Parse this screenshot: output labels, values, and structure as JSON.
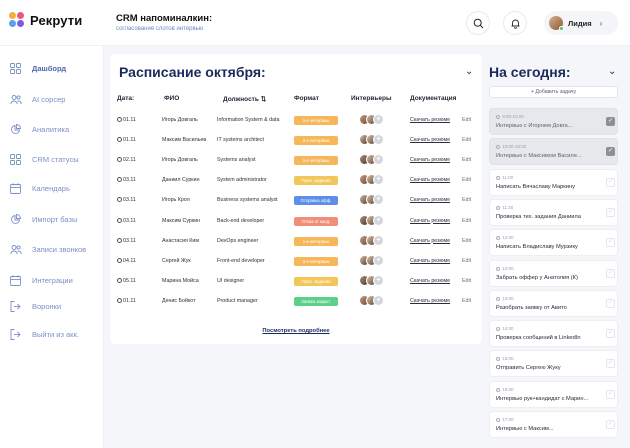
{
  "app": {
    "logo_text": "Рекрути"
  },
  "header": {
    "title": "CRM напоминалкин:",
    "subtitle": "согласование слотов интервью",
    "user_name": "Лидия"
  },
  "sidebar": {
    "items": [
      {
        "label": "Дашборд",
        "icon": "grid-icon",
        "active": true
      },
      {
        "label": "AI сорсер",
        "icon": "people-icon"
      },
      {
        "label": "Аналитика",
        "icon": "pie-chart-icon"
      },
      {
        "label": "CRM статусы",
        "icon": "grid-icon"
      },
      {
        "label": "Календарь",
        "icon": "calendar-icon"
      },
      {
        "label": "Импорт базы",
        "icon": "pie-chart-icon"
      },
      {
        "label": "Записи звонков",
        "icon": "people-icon"
      },
      {
        "label": "Интеграции",
        "icon": "calendar-icon"
      },
      {
        "label": "Воронки",
        "icon": "exit-icon"
      },
      {
        "label": "Выйти из акк.",
        "icon": "exit-icon"
      }
    ]
  },
  "schedule": {
    "title": "Расписание октября:",
    "columns": [
      "Дата:",
      "ФИО",
      "Должность",
      "Формат",
      "Интервьеры",
      "Документация"
    ],
    "download_label": "Скачать резюме",
    "edit_label": "Edit",
    "more_label": "Посмотреть подробнее",
    "rows": [
      {
        "date": "01.11",
        "name": "Игорь Довгаль",
        "position": "Information System & data",
        "format": "2-е интервью",
        "format_color": "#f5b75a"
      },
      {
        "date": "01.11",
        "name": "Максим Васильев",
        "position": "IT systems architect",
        "format": "2-е интервью",
        "format_color": "#f5b75a"
      },
      {
        "date": "02.11",
        "name": "Игорь Довгаль",
        "position": "Systems analyst",
        "format": "2-е интервью",
        "format_color": "#f5b75a"
      },
      {
        "date": "03.11",
        "name": "Даниил Суркин",
        "position": "System administrator",
        "format": "Пров. задания",
        "format_color": "#f3c65a"
      },
      {
        "date": "03.11",
        "name": "Игорь Крол",
        "position": "Business systems analyst",
        "format": "Отправка офф.",
        "format_color": "#5b8fe8"
      },
      {
        "date": "03.11",
        "name": "Максим Суркин",
        "position": "Back-end developer",
        "format": "Отказ от канд.",
        "format_color": "#ef8f7a"
      },
      {
        "date": "03.11",
        "name": "Анастасия Ким",
        "position": "DevOps engineer",
        "format": "1-е интервью",
        "format_color": "#f5b75a"
      },
      {
        "date": "04.11",
        "name": "Сергей Жук",
        "position": "Front-end developer",
        "format": "2-е интервью",
        "format_color": "#f5b75a"
      },
      {
        "date": "05.11",
        "name": "Марина Мойса",
        "position": "UI designer",
        "format": "Пров. задания",
        "format_color": "#f3c65a"
      },
      {
        "date": "01.11",
        "name": "Денис Бойкот",
        "position": "Product manager",
        "format": "Заявка закрыт.",
        "format_color": "#5ccf8a"
      }
    ]
  },
  "today": {
    "title": "На сегодня:",
    "add_label": "+ Добавить задачу",
    "tasks": [
      {
        "time": "9:00-10:00",
        "text": "Интервью с Игорнем Довга...",
        "done": true
      },
      {
        "time": "10:00-10:00",
        "text": "Интервью с Максимом Василе...",
        "done": true
      },
      {
        "time": "11:00",
        "text": "Написать Вячаславу Маркину",
        "done": false
      },
      {
        "time": "11:30",
        "text": "Проверка тех. задания Даниила",
        "done": false
      },
      {
        "time": "12:00",
        "text": "Написать Владиславу Мурзику",
        "done": false
      },
      {
        "time": "12:00",
        "text": "Забрать оффер у Анатолия (К)",
        "done": false
      },
      {
        "time": "13:00",
        "text": "Разобрать заявку от Авито",
        "done": false
      },
      {
        "time": "14:00",
        "text": "Проверка сообщений в LinkedIn",
        "done": false
      },
      {
        "time": "15:00",
        "text": "Отправить Сергею Жуку",
        "done": false
      },
      {
        "time": "16:00",
        "text": "Интервью рук+кандидат с Марин...",
        "done": false
      },
      {
        "time": "17:00",
        "text": "Интервью с Максим...",
        "done": false
      }
    ]
  },
  "colors": {
    "accent": "#4f66b5",
    "title": "#1b2a5c"
  }
}
